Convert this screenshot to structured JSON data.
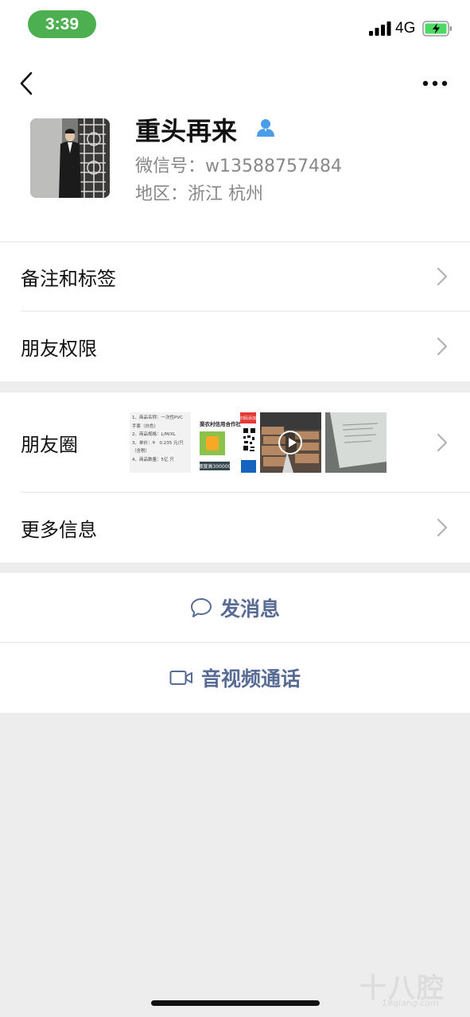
{
  "status_bar": {
    "time": "3:39",
    "network": "4G"
  },
  "profile": {
    "name": "重头再来",
    "wechat_id": "微信号：w13588757484",
    "region": "地区：浙江 杭州"
  },
  "menu": {
    "remarks_tags": "备注和标签",
    "friend_permissions": "朋友权限",
    "moments": "朋友圈",
    "more_info": "更多信息"
  },
  "moments_thumbs": {
    "thumb1_lines": [
      "1、商品名称：一次性PVC",
      "手套（白色）",
      "2、商品规格：L/M/XL",
      "3、单价：¥　0.235 元/只",
      "（含税）",
      "4、商品数量：5亿 只"
    ],
    "thumb2_title": "渠农村信用合作社",
    "thumb2_badge": "扫码添加",
    "thumb2_amount": "额度高300000"
  },
  "actions": {
    "send_message": "发消息",
    "video_call": "音视频通话"
  },
  "watermark": {
    "main": "十八腔",
    "sub": "18qiang.com"
  },
  "colors": {
    "accent": "#576b95",
    "status_pill": "#4caf50",
    "background": "#ededed"
  }
}
